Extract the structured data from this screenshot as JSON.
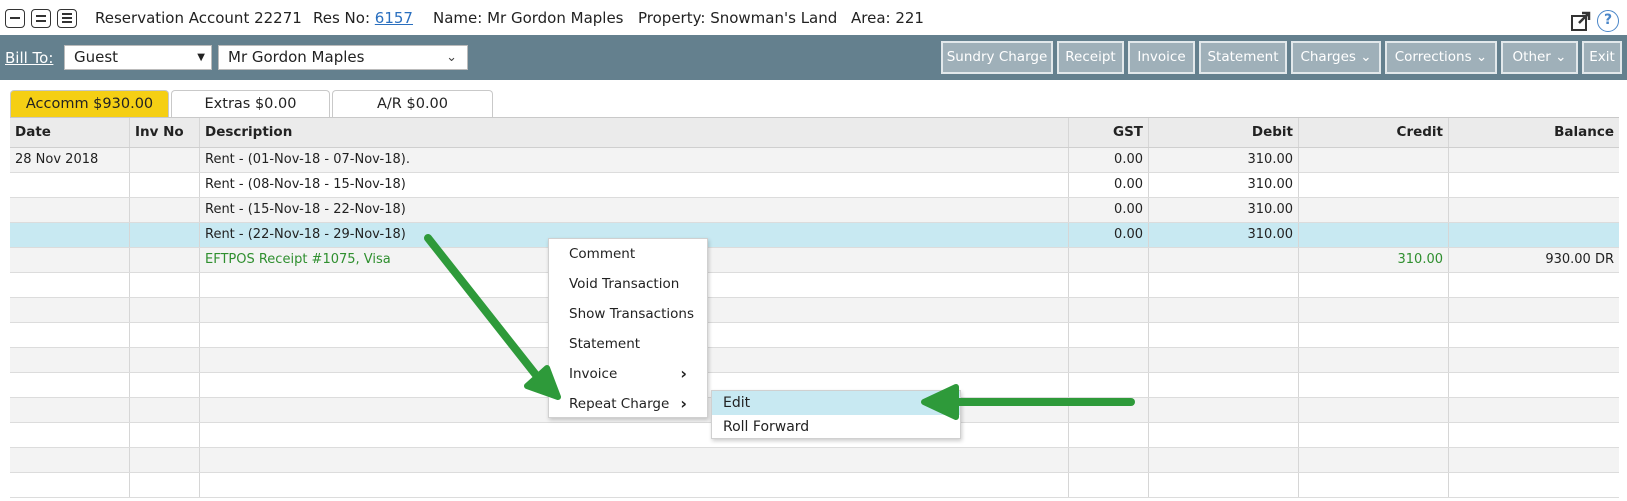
{
  "header": {
    "view_icons": [
      "view-compact-icon",
      "view-normal-icon",
      "view-expanded-icon"
    ],
    "account_title": "Reservation Account 22271",
    "res_no_label": "Res No:",
    "res_no_value": "6157",
    "name": "Name: Mr Gordon Maples",
    "property": "Property: Snowman's Land",
    "area": "Area: 221",
    "help_glyph": "?"
  },
  "bill": {
    "label": "Bill To:",
    "type_value": "Guest",
    "name_value": "Mr Gordon Maples"
  },
  "buttons": {
    "sundry": "Sundry Charge",
    "receipt": "Receipt",
    "invoice": "Invoice",
    "statement": "Statement",
    "charges": "Charges ⌄",
    "corrections": "Corrections ⌄",
    "other": "Other ⌄",
    "exit": "Exit"
  },
  "tabs": {
    "accomm": "Accomm $930.00",
    "extras": "Extras $0.00",
    "ar": "A/R $0.00"
  },
  "table": {
    "columns": {
      "date": "Date",
      "inv": "Inv No",
      "desc": "Description",
      "gst": "GST",
      "debit": "Debit",
      "credit": "Credit",
      "balance": "Balance"
    },
    "rows": [
      {
        "date": "28 Nov 2018",
        "inv": "",
        "desc": "Rent - (01-Nov-18 - 07-Nov-18).",
        "gst": "0.00",
        "debit": "310.00",
        "credit": "",
        "balance": ""
      },
      {
        "date": "",
        "inv": "",
        "desc": "Rent - (08-Nov-18 - 15-Nov-18)",
        "gst": "0.00",
        "debit": "310.00",
        "credit": "",
        "balance": ""
      },
      {
        "date": "",
        "inv": "",
        "desc": "Rent - (15-Nov-18 - 22-Nov-18)",
        "gst": "0.00",
        "debit": "310.00",
        "credit": "",
        "balance": ""
      },
      {
        "date": "",
        "inv": "",
        "desc": "Rent - (22-Nov-18 - 29-Nov-18)",
        "gst": "0.00",
        "debit": "310.00",
        "credit": "",
        "balance": ""
      },
      {
        "date": "",
        "inv": "",
        "desc": "EFTPOS Receipt #1075, Visa",
        "gst": "",
        "debit": "",
        "credit": "310.00",
        "balance": "930.00 DR"
      }
    ]
  },
  "context_menu": {
    "items": [
      "Comment",
      "Void Transaction",
      "Show Transactions",
      "Statement",
      "Invoice",
      "Repeat Charge"
    ],
    "submenu_glyph": "›",
    "submenu": [
      "Edit",
      "Roll Forward"
    ]
  },
  "colors": {
    "accent_tab": "#f5cf14",
    "bar": "#64808e",
    "selected_row": "#c8e9f2",
    "arrow": "#2e9a3a"
  }
}
